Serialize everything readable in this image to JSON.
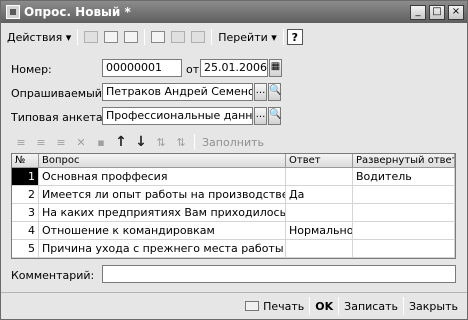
{
  "window": {
    "title": "Опрос. Новый *",
    "min_glyph": "_",
    "max_glyph": "□",
    "close_glyph": "×"
  },
  "toolbar": {
    "actions_label": "Действия",
    "goto_label": "Перейти",
    "help_label": "?",
    "dropdown_glyph": "▾"
  },
  "form": {
    "number_label": "Номер:",
    "number_value": "00000001",
    "date_label": "от:",
    "date_value": "25.01.2006",
    "respondent_label": "Опрашиваемый:",
    "respondent_value": "Петраков Андрей Семенович",
    "template_label": "Типовая анкета:",
    "template_value": "Профессиональные данные",
    "select_glyph": "...",
    "open_glyph": "🔍",
    "comment_label": "Комментарий:",
    "comment_value": ""
  },
  "table_toolbar": {
    "up_glyph": "↑",
    "down_glyph": "↓",
    "fill_label": "Заполнить"
  },
  "table": {
    "columns": [
      "№",
      "Вопрос",
      "Ответ",
      "Развернутый ответ"
    ],
    "rows": [
      {
        "n": "1",
        "question": "Основная проффесия",
        "answer": "",
        "detail": "Водитель"
      },
      {
        "n": "2",
        "question": "Имеется ли опыт работы на производстве?",
        "answer": "Да",
        "detail": ""
      },
      {
        "n": "3",
        "question": "На каких предприятиях Вам приходилось работать",
        "answer": "",
        "detail": ""
      },
      {
        "n": "4",
        "question": "Отношение к командировкам",
        "answer": "Нормальное",
        "detail": ""
      },
      {
        "n": "5",
        "question": "Причина ухода с прежнего места работы",
        "answer": "",
        "detail": ""
      }
    ]
  },
  "footer": {
    "print_label": "Печать",
    "ok_label": "OK",
    "save_label": "Записать",
    "close_label": "Закрыть"
  }
}
